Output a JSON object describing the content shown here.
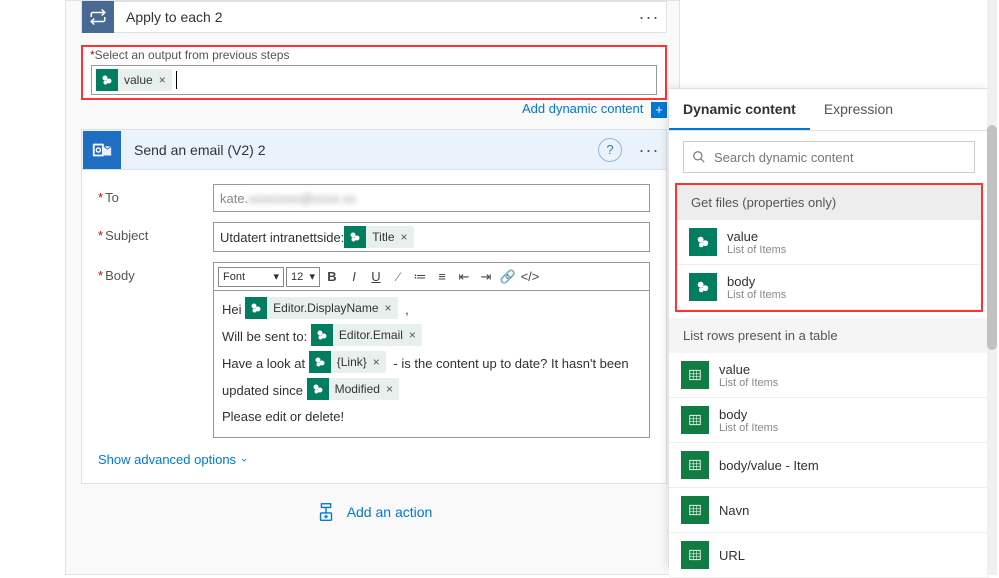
{
  "apply_each": {
    "title": "Apply to each 2"
  },
  "select_output": {
    "label": "Select an output from previous steps",
    "token": "value"
  },
  "dyn_link": "Add dynamic content",
  "email": {
    "title": "Send an email (V2) 2",
    "to_label": "To",
    "to_value_visible": "kate.",
    "to_value_blurred": "xxxxxxxx@xxxx.xx",
    "subject_label": "Subject",
    "subject_prefix": "Utdatert intranettside: ",
    "subject_token": "Title",
    "body_label": "Body",
    "toolbar": {
      "font": "Font",
      "size": "12"
    },
    "body": {
      "l1a": "Hei",
      "l1_token": "Editor.DisplayName",
      "l1b": ",",
      "l2a": "Will be sent to:",
      "l2_token": "Editor.Email",
      "l3a": "Have a look at",
      "l3_token": "{Link}",
      "l3b": " - is the content up to date? It hasn't been",
      "l4a": "updated since",
      "l4_token": "Modified",
      "l5": "Please edit or delete!"
    },
    "advanced": "Show advanced options"
  },
  "add_action": "Add an action",
  "panel": {
    "tab1": "Dynamic content",
    "tab2": "Expression",
    "search_placeholder": "Search dynamic content",
    "group1": "Get files (properties only)",
    "g1_items": [
      {
        "name": "value",
        "desc": "List of Items"
      },
      {
        "name": "body",
        "desc": "List of Items"
      }
    ],
    "group2": "List rows present in a table",
    "g2_items": [
      {
        "name": "value",
        "desc": "List of Items"
      },
      {
        "name": "body",
        "desc": "List of Items"
      },
      {
        "name": "body/value - Item",
        "desc": ""
      },
      {
        "name": "Navn",
        "desc": ""
      },
      {
        "name": "URL",
        "desc": ""
      }
    ]
  }
}
